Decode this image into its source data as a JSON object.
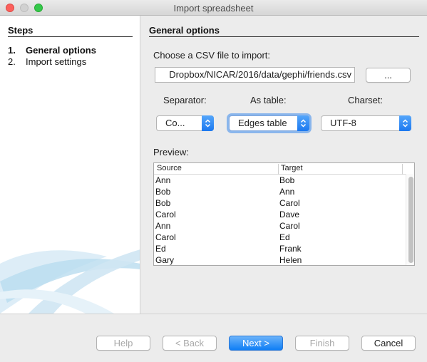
{
  "window": {
    "title": "Import spreadsheet"
  },
  "steps": {
    "title": "Steps",
    "items": [
      {
        "num": "1.",
        "label": "General options"
      },
      {
        "num": "2.",
        "label": "Import settings"
      }
    ]
  },
  "main": {
    "title": "General options",
    "file_label": "Choose a CSV file to import:",
    "file_path": "Dropbox/NICAR/2016/data/gephi/friends.csv",
    "browse_label": "...",
    "separator_label": "Separator:",
    "separator_value": "Co...",
    "table_label": "As table:",
    "table_value": "Edges table",
    "charset_label": "Charset:",
    "charset_value": "UTF-8",
    "preview_label": "Preview:",
    "preview": {
      "columns": [
        "Source",
        "Target"
      ],
      "rows": [
        [
          "Ann",
          "Bob"
        ],
        [
          "Bob",
          "Ann"
        ],
        [
          "Bob",
          "Carol"
        ],
        [
          "Carol",
          "Dave"
        ],
        [
          "Ann",
          "Carol"
        ],
        [
          "Carol",
          "Ed"
        ],
        [
          "Ed",
          "Frank"
        ],
        [
          "Gary",
          "Helen"
        ]
      ]
    }
  },
  "buttons": {
    "help": "Help",
    "back": "< Back",
    "next": "Next >",
    "finish": "Finish",
    "cancel": "Cancel"
  }
}
